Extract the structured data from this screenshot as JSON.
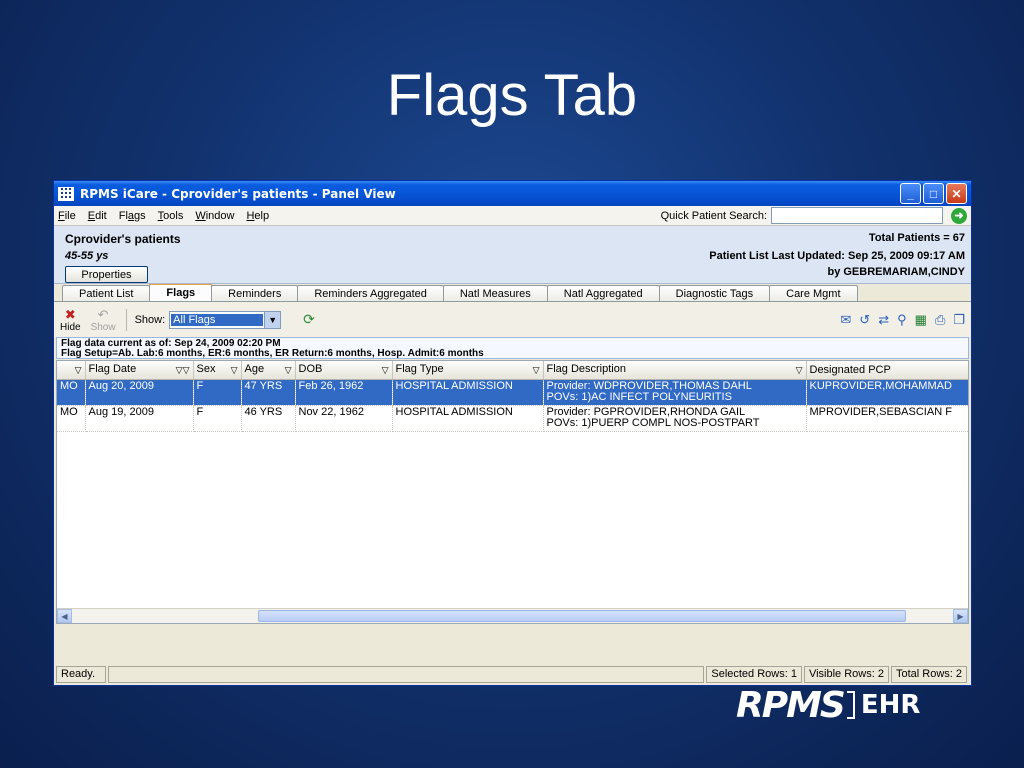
{
  "slide_title": "Flags Tab",
  "window": {
    "title": "RPMS iCare - Cprovider's patients - Panel View",
    "controls": {
      "minimize": "_",
      "maximize": "□",
      "close": "✕"
    }
  },
  "menu": {
    "items": [
      {
        "u": "F",
        "rest": "ile"
      },
      {
        "u": "E",
        "rest": "dit"
      },
      {
        "pre": "Fl",
        "u": "a",
        "rest": "gs"
      },
      {
        "u": "T",
        "rest": "ools"
      },
      {
        "u": "W",
        "rest": "indow"
      },
      {
        "u": "H",
        "rest": "elp"
      }
    ],
    "quick_search_label": "Quick Patient Search:",
    "quick_search_value": ""
  },
  "panel": {
    "name": "Cprovider's patients",
    "age_range": "45-55 ys",
    "properties_button": "Properties",
    "total_patients": "Total Patients = 67",
    "last_updated": "Patient List Last Updated: Sep 25, 2009 09:17 AM",
    "updated_by": "by GEBREMARIAM,CINDY"
  },
  "tabs": [
    "Patient List",
    "Flags",
    "Reminders",
    "Reminders Aggregated",
    "Natl Measures",
    "Natl Aggregated",
    "Diagnostic Tags",
    "Care Mgmt"
  ],
  "active_tab": "Flags",
  "toolbar": {
    "hide_label": "Hide",
    "show_btn_label": "Show",
    "show_label": "Show:",
    "show_value": "All Flags"
  },
  "info": {
    "line1": "Flag data current as of: Sep 24, 2009 02:20 PM",
    "line2": "Flag Setup=Ab. Lab:6 months, ER:6 months, ER Return:6 months, Hosp. Admit:6 months"
  },
  "grid": {
    "columns": [
      "",
      "Flag Date",
      "Sex",
      "Age",
      "DOB",
      "Flag Type",
      "Flag Description",
      "Designated PCP"
    ],
    "rows": [
      {
        "c0": "MO",
        "flag_date": "Aug 20, 2009",
        "sex": "F",
        "age": "47 YRS",
        "dob": "Feb 26, 1962",
        "flag_type": "HOSPITAL ADMISSION",
        "desc1": "Provider: WDPROVIDER,THOMAS DAHL",
        "desc2": "POVs: 1)AC INFECT POLYNEURITIS",
        "pcp": "KUPROVIDER,MOHAMMAD"
      },
      {
        "c0": "MO",
        "flag_date": "Aug 19, 2009",
        "sex": "F",
        "age": "46 YRS",
        "dob": "Nov 22, 1962",
        "flag_type": "HOSPITAL ADMISSION",
        "desc1": "Provider: PGPROVIDER,RHONDA GAIL",
        "desc2": "POVs: 1)PUERP COMPL NOS-POSTPART",
        "pcp": "MPROVIDER,SEBASCIAN F"
      }
    ]
  },
  "status": {
    "main": "Ready.",
    "selected": "Selected Rows: 1",
    "visible": "Visible Rows: 2",
    "total": "Total Rows: 2"
  },
  "logo": {
    "brand": "RPMS",
    "suffix": "EHR"
  }
}
